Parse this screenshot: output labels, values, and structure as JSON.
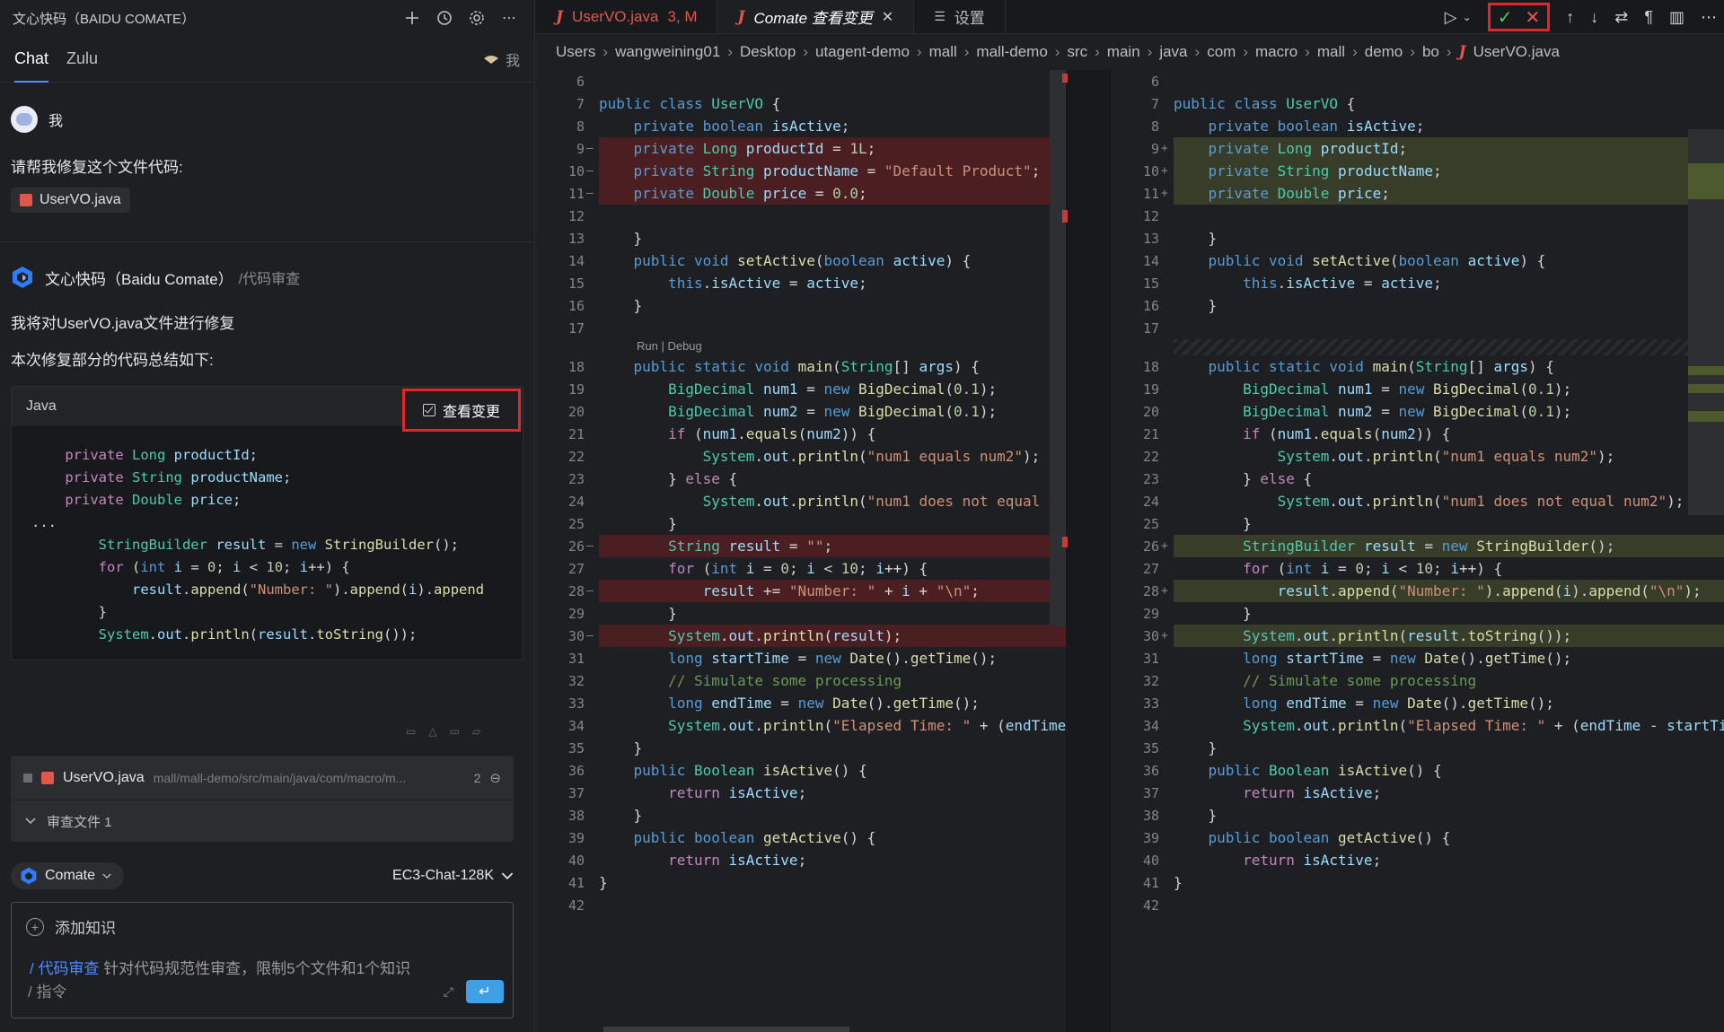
{
  "chat": {
    "title": "文心快码（BAIDU COMATE）",
    "tabs": [
      "Chat",
      "Zulu"
    ],
    "me_label": "我",
    "user": {
      "name": "我",
      "message": "请帮我修复这个文件代码:",
      "file": "UserVO.java"
    },
    "bot": {
      "name": "文心快码（Baidu Comate）",
      "tag": "/代码审查",
      "line1": "我将对UserVO.java文件进行修复",
      "line2": "本次修复部分的代码总结如下:",
      "code_lang": "Java",
      "view_changes": "查看变更"
    },
    "review": {
      "file": "UserVO.java",
      "path": "mall/mall-demo/src/main/java/com/macro/m...",
      "count": "2",
      "files_label": "审查文件 1"
    },
    "model": {
      "agent": "Comate",
      "name": "EC3-Chat-128K"
    },
    "input": {
      "add_knowledge": "添加知识",
      "hint_cmd": "/ 代码审查",
      "hint_text": "针对代码规范性审查，限制5个文件和1个知识",
      "placeholder": "/ 指令"
    }
  },
  "editor": {
    "tabs": [
      {
        "label": "UserVO.java",
        "suffix": "3, M"
      },
      {
        "label": "Comate 查看变更"
      },
      {
        "label": "设置"
      }
    ],
    "breadcrumb": [
      "Users",
      "wangweining01",
      "Desktop",
      "utagent-demo",
      "mall",
      "mall-demo",
      "src",
      "main",
      "java",
      "com",
      "macro",
      "mall",
      "demo",
      "bo",
      "UserVO.java"
    ],
    "codelens": "Run | Debug"
  },
  "colors": {
    "accent": "#4c8dff",
    "highlight_box": "#e4262a",
    "deleted_bg": "#4b1f21",
    "added_bg": "#373d29"
  }
}
